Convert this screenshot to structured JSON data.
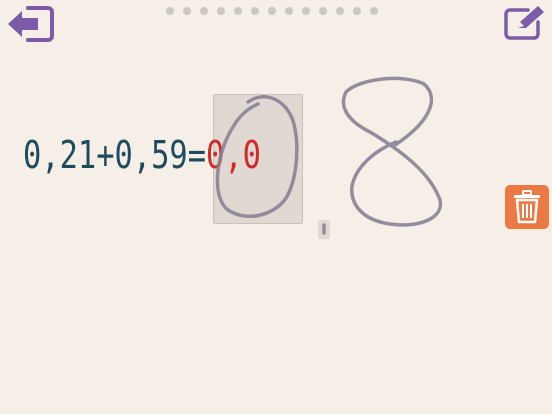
{
  "header": {
    "back_icon": "exit-arrow-icon",
    "edit_icon": "pencil-square-icon",
    "progress_dots": 13,
    "icon_color": "#7c5ca8"
  },
  "equation": {
    "expression": "0,21+0,59=",
    "answer_typed": "0,0"
  },
  "colors": {
    "equation": "#1e4b5e",
    "answer": "#d3272a",
    "trash": "#ec7943",
    "ink": "#8a8296"
  },
  "tools": {
    "trash_icon": "trash-icon"
  }
}
